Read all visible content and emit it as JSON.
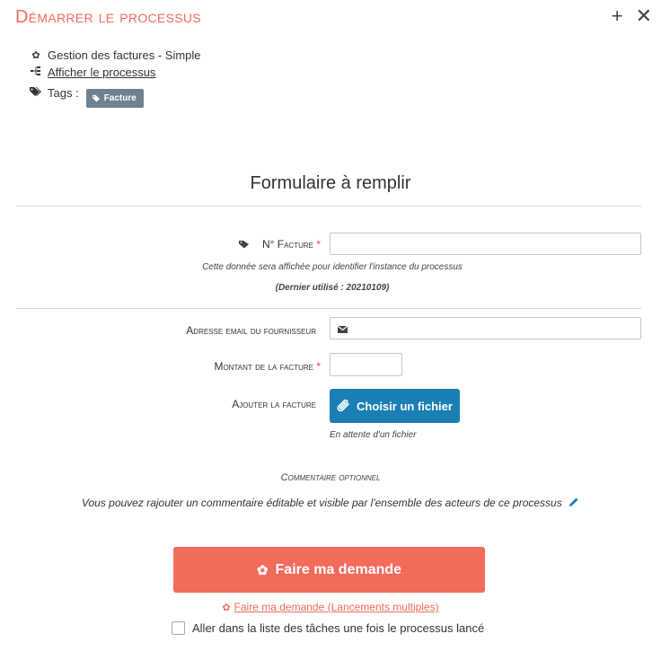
{
  "header": {
    "title": "Démarrer le processus",
    "add_icon": "plus-icon",
    "close_icon": "close-icon"
  },
  "meta": {
    "process_name": "Gestion des factures - Simple",
    "view_process_link": "Afficher le processus",
    "tags_label": "Tags :",
    "tags": [
      "Facture"
    ]
  },
  "form": {
    "title": "Formulaire à remplir",
    "invoice_number": {
      "label": "N° Facture",
      "required": "*",
      "value": "",
      "help_1": "Cette donnée sera affichée pour identifier l'instance du processus",
      "help_2": "(Dernier utilisé : 20210109)"
    },
    "supplier_email": {
      "label": "Adresse email du fournisseur",
      "value": ""
    },
    "invoice_amount": {
      "label": "Montant de la facture",
      "required": "*",
      "value": ""
    },
    "invoice_file": {
      "label": "Ajouter la facture",
      "button": "Choisir un fichier",
      "status": "En attente d'un fichier"
    },
    "comment": {
      "label": "Commentaire optionnel",
      "text": "Vous pouvez rajouter un commentaire éditable et visible par l'ensemble des acteurs de ce processus"
    }
  },
  "actions": {
    "submit": "Faire ma demande",
    "multi_submit": "Faire ma demande (Lancements multiples)",
    "goto_tasks": "Aller dans la liste des tâches une fois le processus lancé",
    "goto_tasks_checked": false
  },
  "colors": {
    "accent": "#f26b5b",
    "file_button": "#1a7fb5",
    "tag": "#708090",
    "required": "#e0463c"
  }
}
